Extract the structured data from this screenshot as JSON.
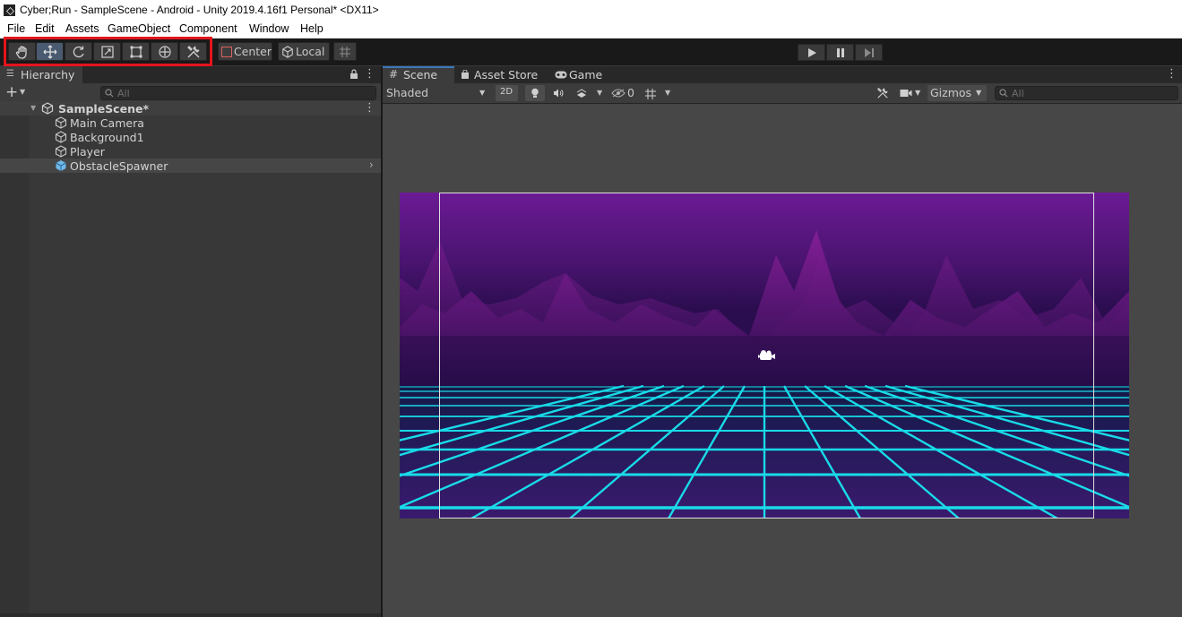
{
  "window": {
    "title": "Cyber;Run - SampleScene - Android - Unity 2019.4.16f1 Personal* <DX11>"
  },
  "menu": [
    "File",
    "Edit",
    "Assets",
    "GameObject",
    "Component",
    "Window",
    "Help"
  ],
  "toolbar": {
    "tools": [
      "hand-tool",
      "move-tool",
      "rotate-tool",
      "scale-tool",
      "rect-tool",
      "transform-tool",
      "custom-editor-tool"
    ],
    "active_tool": "move-tool",
    "pivot_label": "Center",
    "space_label": "Local",
    "highlight_color": "#e4141b"
  },
  "hierarchy": {
    "tab_label": "Hierarchy",
    "search_placeholder": "All",
    "scene_name": "SampleScene*",
    "items": [
      {
        "label": "Main Camera",
        "icon": "gameobject-icon"
      },
      {
        "label": "Background1",
        "icon": "gameobject-icon"
      },
      {
        "label": "Player",
        "icon": "gameobject-icon"
      },
      {
        "label": "ObstacleSpawner",
        "icon": "prefab-icon",
        "selected": true
      }
    ]
  },
  "scene_view": {
    "tabs": [
      "Scene",
      "Asset Store",
      "Game"
    ],
    "active_tab": "Scene",
    "shading_mode": "Shaded",
    "mode_2d_label": "2D",
    "hidden_count": "0",
    "gizmos_label": "Gizmos",
    "search_placeholder": "All",
    "colors": {
      "sky_top": "#6b1a94",
      "grid": "#18e6f0",
      "floor": "#0d1540"
    }
  }
}
